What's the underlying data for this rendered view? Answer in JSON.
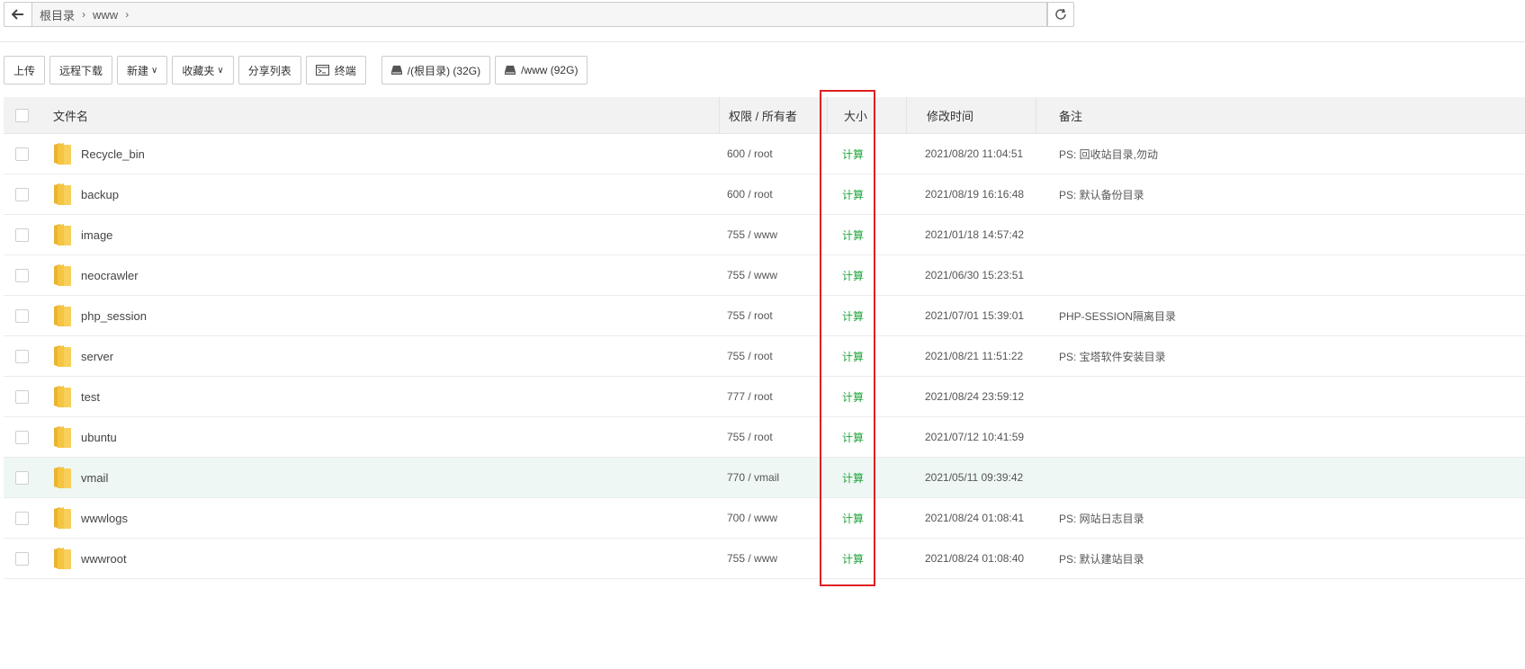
{
  "address_bar": {
    "crumbs": [
      "根目录",
      "www"
    ]
  },
  "toolbar": {
    "upload": "上传",
    "remote_download": "远程下载",
    "new": "新建",
    "favorites": "收藏夹",
    "share_list": "分享列表",
    "terminal": "终端",
    "disk_root": "/(根目录) (32G)",
    "disk_www": "/www (92G)"
  },
  "table": {
    "headers": {
      "name": "文件名",
      "perm": "权限 / 所有者",
      "size": "大小",
      "mtime": "修改时间",
      "note": "备注"
    },
    "rows": [
      {
        "name": "Recycle_bin",
        "perm": "600 / root",
        "size": "计算",
        "mtime": "2021/08/20 11:04:51",
        "note": "PS: 回收站目录,勿动"
      },
      {
        "name": "backup",
        "perm": "600 / root",
        "size": "计算",
        "mtime": "2021/08/19 16:16:48",
        "note": "PS: 默认备份目录"
      },
      {
        "name": "image",
        "perm": "755 / www",
        "size": "计算",
        "mtime": "2021/01/18 14:57:42",
        "note": ""
      },
      {
        "name": "neocrawler",
        "perm": "755 / www",
        "size": "计算",
        "mtime": "2021/06/30 15:23:51",
        "note": ""
      },
      {
        "name": "php_session",
        "perm": "755 / root",
        "size": "计算",
        "mtime": "2021/07/01 15:39:01",
        "note": "PHP-SESSION隔离目录"
      },
      {
        "name": "server",
        "perm": "755 / root",
        "size": "计算",
        "mtime": "2021/08/21 11:51:22",
        "note": "PS: 宝塔软件安装目录"
      },
      {
        "name": "test",
        "perm": "777 / root",
        "size": "计算",
        "mtime": "2021/08/24 23:59:12",
        "note": ""
      },
      {
        "name": "ubuntu",
        "perm": "755 / root",
        "size": "计算",
        "mtime": "2021/07/12 10:41:59",
        "note": ""
      },
      {
        "name": "vmail",
        "perm": "770 / vmail",
        "size": "计算",
        "mtime": "2021/05/11 09:39:42",
        "note": ""
      },
      {
        "name": "wwwlogs",
        "perm": "700 / www",
        "size": "计算",
        "mtime": "2021/08/24 01:08:41",
        "note": "PS: 网站日志目录"
      },
      {
        "name": "wwwroot",
        "perm": "755 / www",
        "size": "计算",
        "mtime": "2021/08/24 01:08:40",
        "note": "PS: 默认建站目录"
      }
    ]
  },
  "colors": {
    "size_link": "#20a53a",
    "highlight_box": "#e02020",
    "hover_row": "#eef7f4",
    "folder": "#f5c542"
  }
}
